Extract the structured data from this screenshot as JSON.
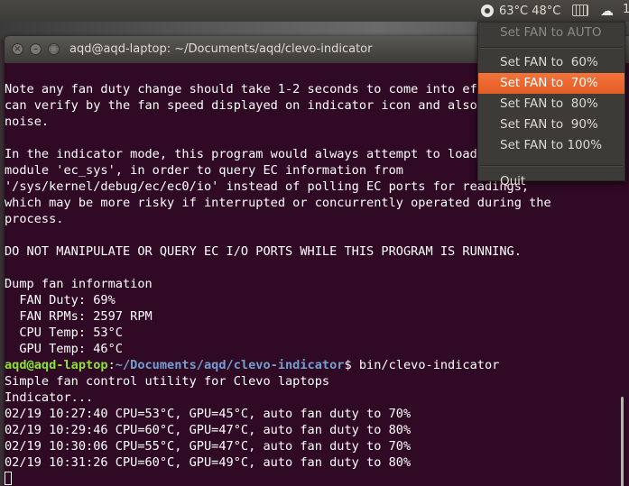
{
  "panel": {
    "temperature": "63°C 48°C",
    "trailing": "1"
  },
  "window": {
    "title": "aqd@aqd-laptop: ~/Documents/aqd/clevo-indicator"
  },
  "terminal": {
    "lines_before_prompt": [
      "Note any fan duty change should take 1-2 seconds to come into effect - you",
      "can verify by the fan speed displayed on indicator icon and also louder fan",
      "noise.",
      "",
      "In the indicator mode, this program would always attempt to load kernel",
      "module 'ec_sys', in order to query EC information from",
      "'/sys/kernel/debug/ec/ec0/io' instead of polling EC ports for readings,",
      "which may be more risky if interrupted or concurrently operated during the",
      "process.",
      "",
      "DO NOT MANIPULATE OR QUERY EC I/O PORTS WHILE THIS PROGRAM IS RUNNING.",
      "",
      "Dump fan information",
      "  FAN Duty: 69%",
      "  FAN RPMs: 2597 RPM",
      "  CPU Temp: 53°C",
      "  GPU Temp: 46°C"
    ],
    "prompt_user": "aqd@aqd-laptop",
    "prompt_sep": ":",
    "prompt_path": "~/Documents/aqd/clevo-indicator",
    "prompt_command": "$ bin/clevo-indicator",
    "lines_after_prompt": [
      "Simple fan control utility for Clevo laptops",
      "Indicator...",
      "02/19 10:27:40 CPU=53°C, GPU=45°C, auto fan duty to 70%",
      "02/19 10:29:46 CPU=60°C, GPU=47°C, auto fan duty to 80%",
      "02/19 10:30:06 CPU=55°C, GPU=47°C, auto fan duty to 70%",
      "02/19 10:31:26 CPU=60°C, GPU=49°C, auto fan duty to 80%"
    ]
  },
  "menu": {
    "items": [
      {
        "label": "Set FAN to AUTO",
        "state": "disabled"
      },
      {
        "label": "Set FAN to  60%",
        "state": "normal"
      },
      {
        "label": "Set FAN to  70%",
        "state": "active"
      },
      {
        "label": "Set FAN to  80%",
        "state": "normal"
      },
      {
        "label": "Set FAN to  90%",
        "state": "normal"
      },
      {
        "label": "Set FAN to 100%",
        "state": "normal"
      },
      {
        "label": "Quit",
        "state": "normal"
      }
    ]
  },
  "colors": {
    "terminal_bg": "#300a24",
    "prompt_user": "#8ae234",
    "prompt_path": "#729fcf",
    "menu_highlight": "#f07746"
  }
}
